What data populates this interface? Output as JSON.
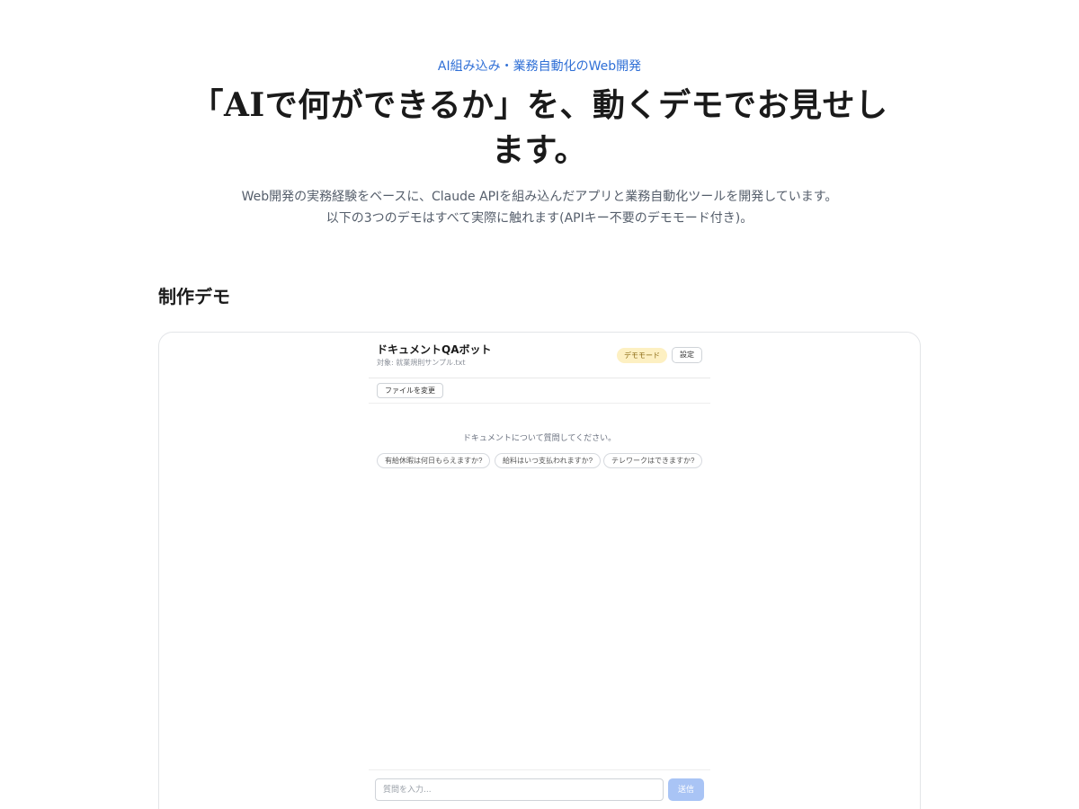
{
  "hero": {
    "eyebrow": "AI組み込み・業務自動化のWeb開発",
    "headline": "「AIで何ができるか」を、動くデモでお見せします。",
    "lead_line1": "Web開発の実務経験をベースに、Claude APIを組み込んだアプリと業務自動化ツールを開発しています。",
    "lead_line2": "以下の3つのデモはすべて実際に触れます(APIキー不要のデモモード付き)。"
  },
  "section": {
    "title": "制作デモ"
  },
  "demo_app": {
    "title": "ドキュメントQAボット",
    "subtitle": "対象: 就業規則サンプル.txt",
    "mode_badge": "デモモード",
    "settings_label": "設定",
    "change_file_label": "ファイルを変更",
    "empty_message": "ドキュメントについて質問してください。",
    "suggestions": [
      "有給休暇は何日もらえますか?",
      "給料はいつ支払われますか?",
      "テレワークはできますか?"
    ],
    "input_placeholder": "質問を入力...",
    "send_label": "送信"
  },
  "colors": {
    "accent": "#2f6fd6",
    "badge_bg": "#fdf0c2",
    "send_disabled": "#a9c4f5"
  }
}
